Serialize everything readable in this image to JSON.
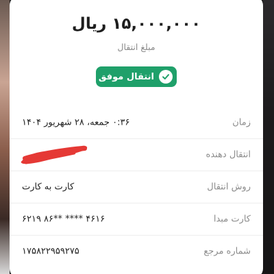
{
  "receipt": {
    "amount": "۱۵,۰۰۰,۰۰۰ ریال",
    "amount_caption": "مبلغ انتقال",
    "status_label": "انتقال موفق",
    "rows": [
      {
        "label": "زمان",
        "value": "۰:۳۶ جمعه، ۲۸ شهریور ۱۴۰۴"
      },
      {
        "label": "انتقال دهنده",
        "value": ""
      },
      {
        "label": "روش انتقال",
        "value": "کارت به کارت"
      },
      {
        "label": "کارت مبدا",
        "value": "۶۲۱۹ ۸۶** **** ۴۶۱۶"
      },
      {
        "label": "شماره مرجع",
        "value": "۱۷۵۸۲۲۹۵۹۲۷۵"
      }
    ]
  },
  "colors": {
    "success": "#1fa06a",
    "redaction": "#e53935"
  },
  "icons": {
    "status": "check-icon"
  }
}
